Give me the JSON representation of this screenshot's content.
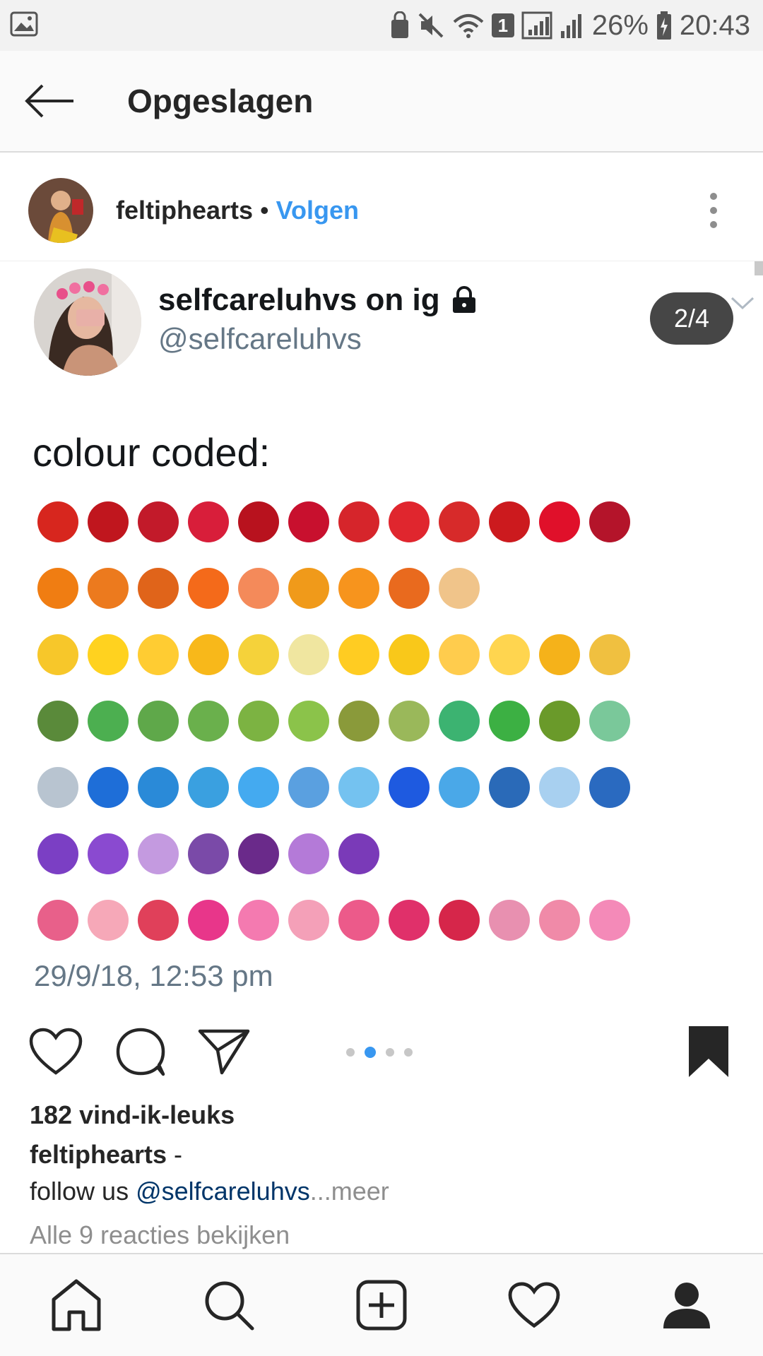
{
  "status_bar": {
    "battery": "26%",
    "time": "20:43",
    "sim_label": "1"
  },
  "app_bar": {
    "title": "Opgeslagen"
  },
  "post": {
    "username": "feltiphearts",
    "separator": "•",
    "follow_label": "Volgen",
    "carousel": {
      "counter": "2/4",
      "active_index": 1,
      "total": 4,
      "tweet": {
        "display_name": "selfcareluhvs on ig",
        "handle": "@selfcareluhvs",
        "text": "colour coded:",
        "date": "29/9/18, 12:53 pm",
        "emoji_rows": [
          [
            "#d7261e",
            "#c0161e",
            "#c21a2a",
            "#d81e3a",
            "#b8121e",
            "#c8102e",
            "#d6252b",
            "#e0262e",
            "#d72a2a",
            "#cc1a1e",
            "#e0102a",
            "#b4142a"
          ],
          [
            "#f07d12",
            "#ec7a1e",
            "#e0641a",
            "#f46a1a",
            "#f48a5a",
            "#f09a1a",
            "#f7941d",
            "#e96a1e",
            "#f0c48a"
          ],
          [
            "#f7c72a",
            "#ffd21f",
            "#ffcc32",
            "#f8b81a",
            "#f5d23a",
            "#f0e6a0",
            "#ffcc22",
            "#f9c81a",
            "#ffcc4d",
            "#ffd54f",
            "#f5b21a",
            "#f0c040"
          ],
          [
            "#5a8a3a",
            "#4caf50",
            "#5fa84a",
            "#6ab04c",
            "#7cb342",
            "#8bc34a",
            "#8a9a3a",
            "#9ab85a",
            "#3cb371",
            "#3cb043",
            "#6a9a2a",
            "#7ac89a"
          ],
          [
            "#b8c4d0",
            "#1e6ed8",
            "#2a8ad8",
            "#3aa0e0",
            "#44aaf0",
            "#5aa0e0",
            "#74c2f0",
            "#1e5ae0",
            "#4aa8e8",
            "#2a6ab8",
            "#a8d0f0",
            "#2a6ac0"
          ],
          [
            "#7b3fc4",
            "#8a4ad0",
            "#c49ae0",
            "#7a4aa8",
            "#6a2a8a",
            "#b47ad8",
            "#7a3ab8"
          ],
          [
            "#e8608a",
            "#f6a8b8",
            "#e0405a",
            "#e8368a",
            "#f47ab0",
            "#f4a0b8",
            "#ec5a8a",
            "#e0306a",
            "#d6264a",
            "#e890b0",
            "#f08aa8",
            "#f48ab8"
          ]
        ]
      }
    },
    "likes": "182 vind-ik-leuks",
    "caption_user": "feltiphearts",
    "caption_dash": " -",
    "caption_prefix": "follow us ",
    "caption_mention": "@selfcareluhvs",
    "caption_more": "...meer",
    "comments_link": "Alle 9 reacties bekijken"
  },
  "colors": {
    "accent": "#3897f0",
    "mention": "#003569",
    "muted": "#8e8e8e"
  }
}
